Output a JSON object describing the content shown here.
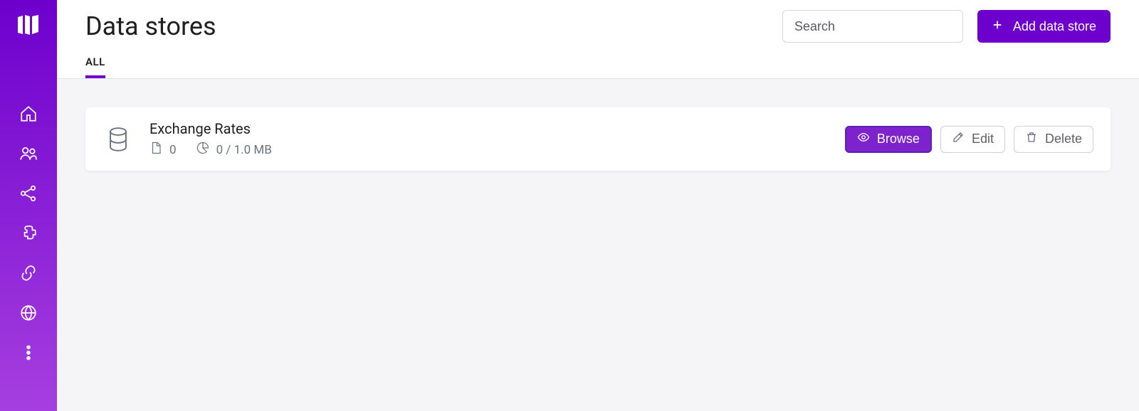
{
  "header": {
    "title": "Data stores",
    "search_placeholder": "Search",
    "add_label": "Add data store"
  },
  "tabs": {
    "all": "ALL"
  },
  "stores": [
    {
      "name": "Exchange Rates",
      "record_count": "0",
      "usage": "0 / 1.0 MB",
      "browse_label": "Browse",
      "edit_label": "Edit",
      "delete_label": "Delete"
    }
  ]
}
